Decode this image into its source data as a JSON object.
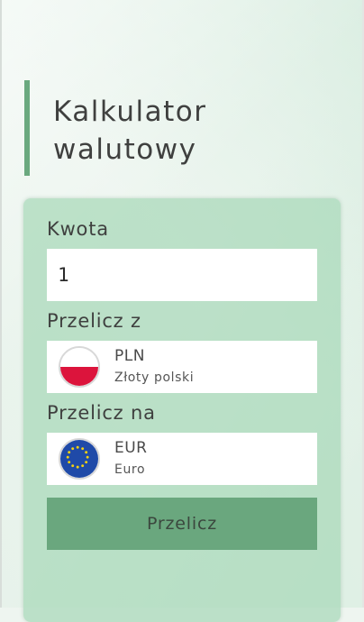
{
  "title": {
    "line1": "Kalkulator",
    "line2": "walutowy"
  },
  "form": {
    "amount_label": "Kwota",
    "amount_value": "1",
    "from_label": "Przelicz z",
    "from": {
      "code": "PLN",
      "name": "Złoty polski",
      "flag": "poland-flag-icon"
    },
    "to_label": "Przelicz na",
    "to": {
      "code": "EUR",
      "name": "Euro",
      "flag": "eu-flag-icon"
    },
    "submit_label": "Przelicz"
  },
  "colors": {
    "accent": "#6aa97f",
    "card": "#a8d8b8",
    "button": "#6aa77e",
    "text": "#3f403f"
  }
}
